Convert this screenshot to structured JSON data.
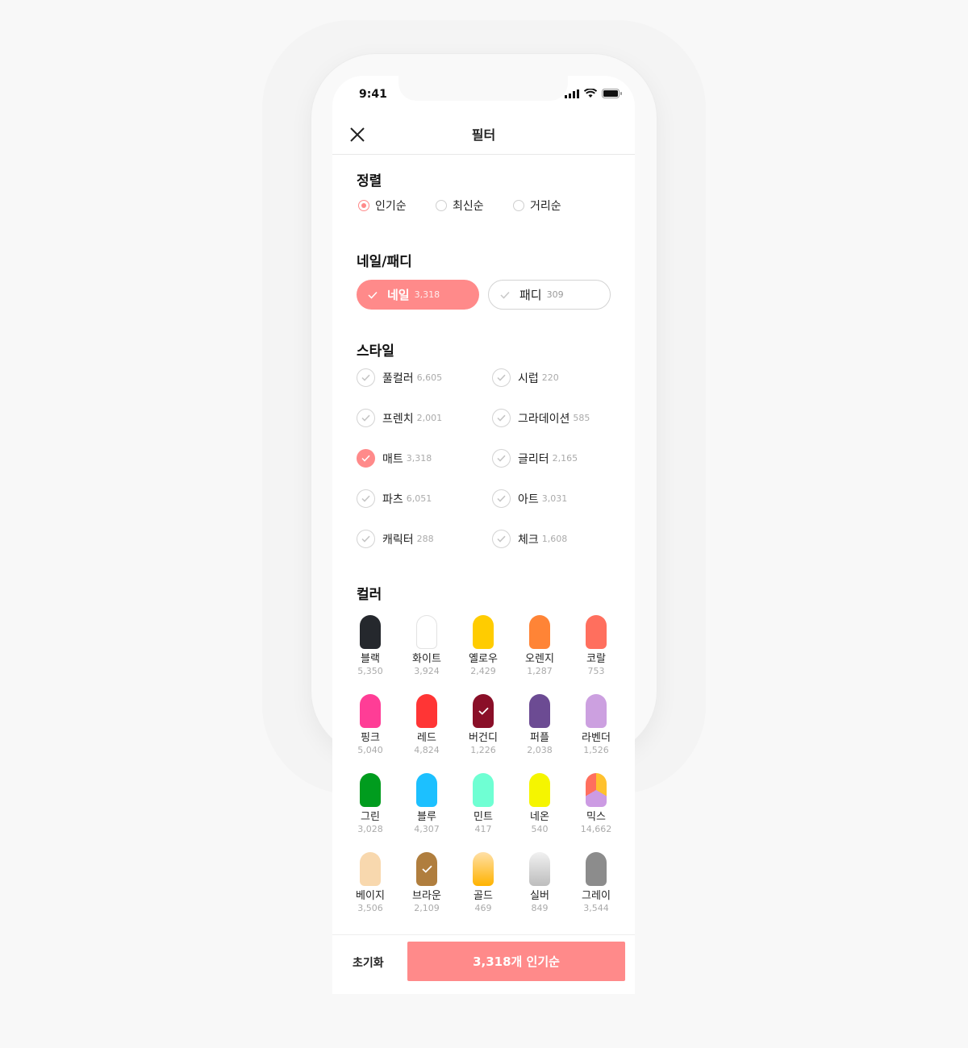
{
  "status": {
    "time": "9:41"
  },
  "header": {
    "title": "필터"
  },
  "sort": {
    "title": "정렬",
    "options": [
      {
        "label": "인기순",
        "selected": true
      },
      {
        "label": "최신순",
        "selected": false
      },
      {
        "label": "거리순",
        "selected": false
      }
    ]
  },
  "type": {
    "title": "네일/패디",
    "options": [
      {
        "label": "네일",
        "count": "3,318",
        "selected": true
      },
      {
        "label": "패디",
        "count": "309",
        "selected": false
      }
    ]
  },
  "style": {
    "title": "스타일",
    "items": [
      {
        "label": "풀컬러",
        "count": "6,605",
        "selected": false
      },
      {
        "label": "시럽",
        "count": "220",
        "selected": false
      },
      {
        "label": "프렌치",
        "count": "2,001",
        "selected": false
      },
      {
        "label": "그라데이션",
        "count": "585",
        "selected": false
      },
      {
        "label": "매트",
        "count": "3,318",
        "selected": true
      },
      {
        "label": "글리터",
        "count": "2,165",
        "selected": false
      },
      {
        "label": "파츠",
        "count": "6,051",
        "selected": false
      },
      {
        "label": "아트",
        "count": "3,031",
        "selected": false
      },
      {
        "label": "캐릭터",
        "count": "288",
        "selected": false
      },
      {
        "label": "체크",
        "count": "1,608",
        "selected": false
      }
    ]
  },
  "color": {
    "title": "컬러",
    "items": [
      {
        "label": "블랙",
        "count": "5,350",
        "color": "#25282d",
        "selected": false
      },
      {
        "label": "화이트",
        "count": "3,924",
        "color": "#ffffff",
        "selected": false
      },
      {
        "label": "옐로우",
        "count": "2,429",
        "color": "#ffcc00",
        "selected": false
      },
      {
        "label": "오렌지",
        "count": "1,287",
        "color": "#ff8436",
        "selected": false
      },
      {
        "label": "코랄",
        "count": "753",
        "color": "#ff6f5e",
        "selected": false
      },
      {
        "label": "핑크",
        "count": "5,040",
        "color": "#ff3d96",
        "selected": false
      },
      {
        "label": "레드",
        "count": "4,824",
        "color": "#ff3535",
        "selected": false
      },
      {
        "label": "버건디",
        "count": "1,226",
        "color": "#8a0f28",
        "selected": true
      },
      {
        "label": "퍼플",
        "count": "2,038",
        "color": "#6c4b93",
        "selected": false
      },
      {
        "label": "라벤더",
        "count": "1,526",
        "color": "#cca0e0",
        "selected": false
      },
      {
        "label": "그린",
        "count": "3,028",
        "color": "#009c1e",
        "selected": false
      },
      {
        "label": "블루",
        "count": "4,307",
        "color": "#1cc0ff",
        "selected": false
      },
      {
        "label": "민트",
        "count": "417",
        "color": "#6fffd3",
        "selected": false
      },
      {
        "label": "네온",
        "count": "540",
        "color": "#f5f500",
        "selected": false
      },
      {
        "label": "믹스",
        "count": "14,662",
        "color": "mix",
        "selected": false
      },
      {
        "label": "베이지",
        "count": "3,506",
        "color": "#f8d8ae",
        "selected": false
      },
      {
        "label": "브라운",
        "count": "2,109",
        "color": "#b07e3e",
        "selected": true
      },
      {
        "label": "골드",
        "count": "469",
        "color": "gold",
        "selected": false
      },
      {
        "label": "실버",
        "count": "849",
        "color": "silver",
        "selected": false
      },
      {
        "label": "그레이",
        "count": "3,544",
        "color": "#8c8c8c",
        "selected": false
      }
    ]
  },
  "footer": {
    "reset": "초기화",
    "apply": "3,318개 인기순"
  },
  "accent": "#ff8a8a"
}
